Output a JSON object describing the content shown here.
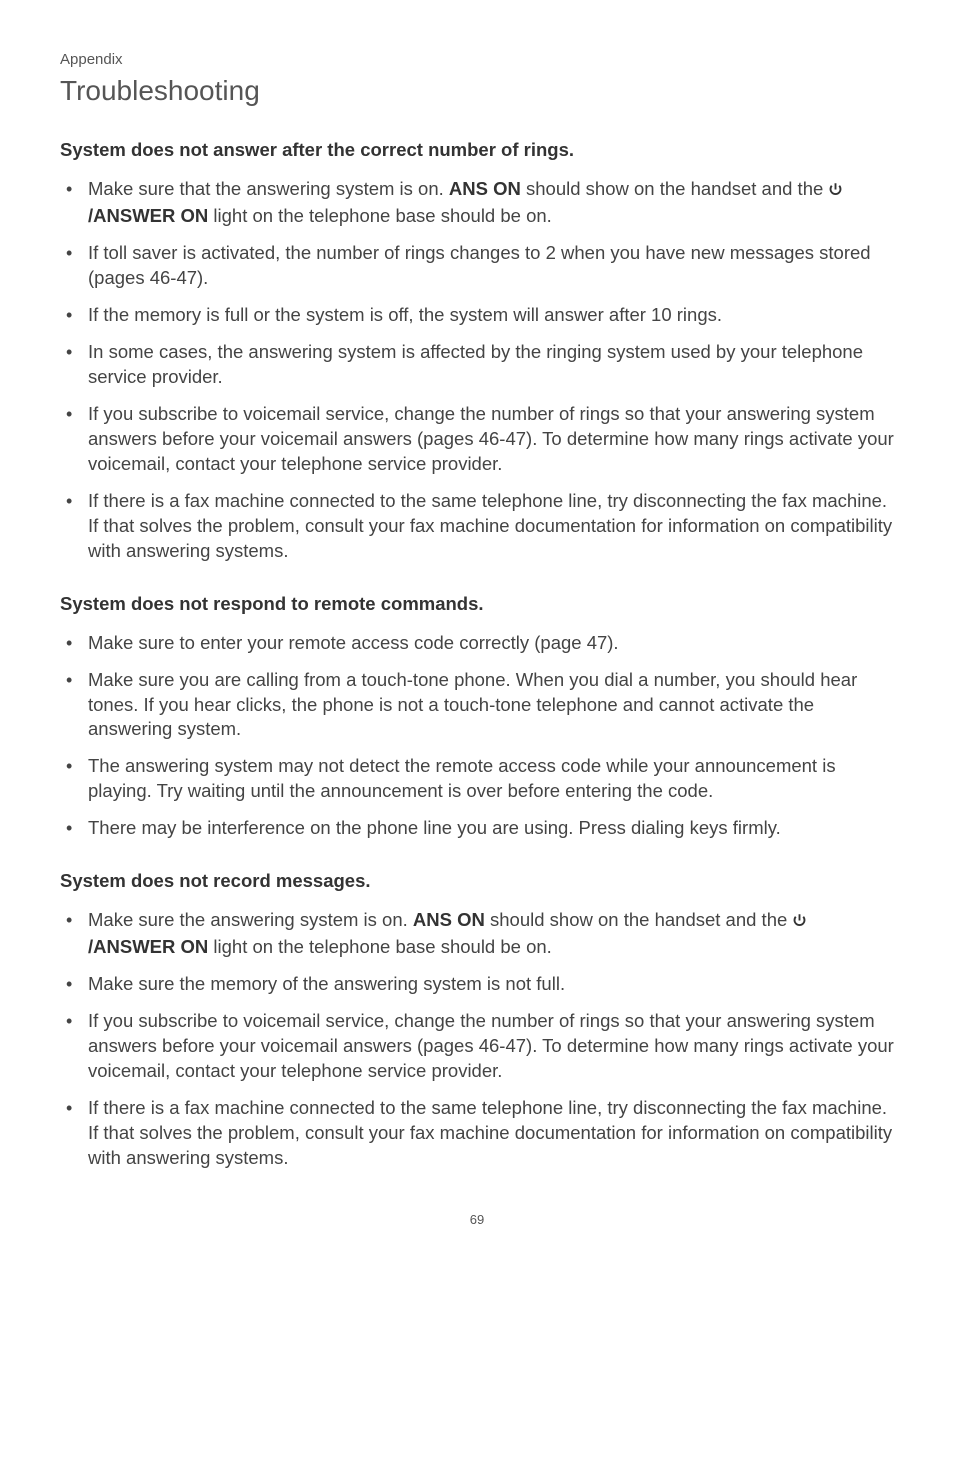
{
  "header": {
    "appendix": "Appendix",
    "title": "Troubleshooting"
  },
  "section1": {
    "heading": "System does not answer after the correct number of rings.",
    "items": {
      "i0a": "Make sure that the answering system is on. ",
      "i0b": "ANS ON",
      "i0c": " should show on the handset and the ",
      "i0d": "/ANSWER ON",
      "i0e": " light on the telephone base should be on.",
      "i1": "If toll saver is activated, the number of rings changes to 2 when you have new messages stored (pages 46-47).",
      "i2": "If the memory is full or the system is off, the system will answer after 10 rings.",
      "i3": "In some cases, the answering system is affected by the ringing system used by your telephone service provider.",
      "i4": "If you subscribe to voicemail service, change the number of rings so that your answering system answers before your voicemail answers (pages 46-47). To determine how many rings activate your voicemail, contact your telephone service provider.",
      "i5": "If there is a fax machine connected to the same telephone line, try disconnecting the fax machine. If that solves the problem, consult your fax machine documentation for information on compatibility with answering systems."
    }
  },
  "section2": {
    "heading": "System does not respond to remote commands.",
    "items": {
      "i0": "Make sure to enter your remote access code correctly (page 47).",
      "i1": "Make sure you are calling from a touch-tone phone. When you dial a number, you should hear tones. If you hear clicks, the phone is not a touch-tone telephone and cannot activate the answering system.",
      "i2": "The answering system may not detect the remote access code while your announcement is playing. Try waiting until the announcement is over before entering the code.",
      "i3": "There may be interference on the phone line you are using. Press dialing keys firmly."
    }
  },
  "section3": {
    "heading": "System does not record messages.",
    "items": {
      "i0a": "Make sure the answering system is on. ",
      "i0b": "ANS ON",
      "i0c": " should show on the handset and the ",
      "i0d": "/ANSWER ON",
      "i0e": " light on the telephone base should be on.",
      "i1": "Make sure the memory of the answering system is not full.",
      "i2": "If you subscribe to voicemail service, change the number of rings so that your answering system answers before your voicemail answers (pages 46-47). To determine how many rings activate your voicemail, contact your telephone service provider.",
      "i3": "If there is a fax machine connected to the same telephone line, try disconnecting the fax machine. If that solves the problem, consult your fax machine documentation for information on compatibility with answering systems."
    }
  },
  "pageNumber": "69"
}
